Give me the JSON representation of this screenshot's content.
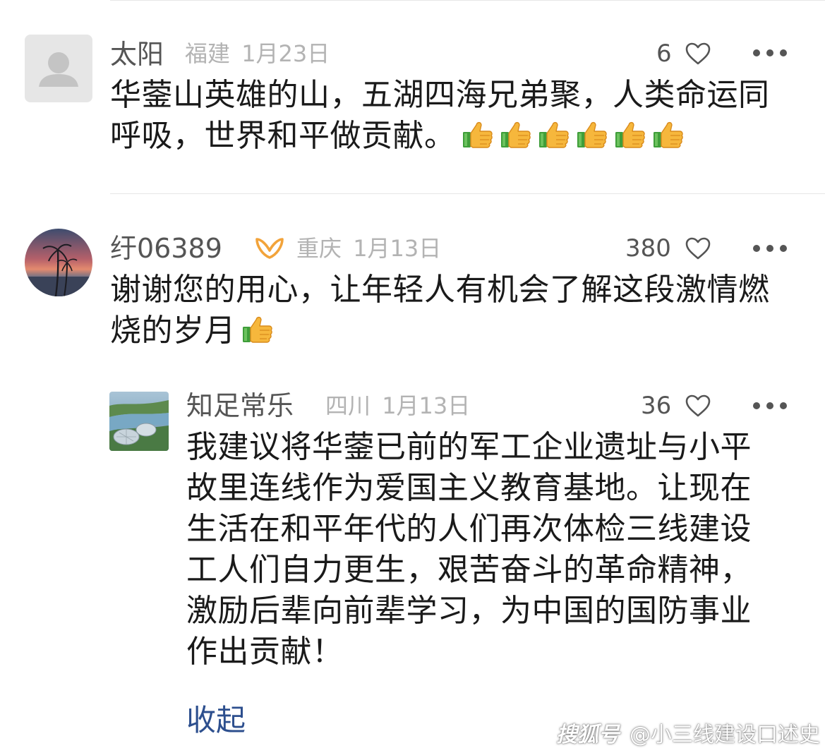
{
  "comments": [
    {
      "username": "太阳",
      "location": "福建",
      "date": "1月23日",
      "likes": "6",
      "text": "华蓥山英雄的山，五湖四海兄弟聚，人类命运同呼吸，世界和平做贡献。",
      "emoji": [
        "thumbs-up",
        "thumbs-up",
        "thumbs-up",
        "thumbs-up",
        "thumbs-up",
        "thumbs-up"
      ]
    },
    {
      "username": "纡06389",
      "location": "重庆",
      "date": "1月13日",
      "likes": "380",
      "text": "谢谢您的用心，让年轻人有机会了解这段激情燃烧的岁月",
      "emoji": [
        "thumbs-up"
      ]
    },
    {
      "username": "知足常乐",
      "location": "四川",
      "date": "1月13日",
      "likes": "36",
      "text": "我建议将华蓥已前的军工企业遗址与小平故里连线作为爱国主义教育基地。让现在生活在和平年代的人们再次体检三线建设工人们自力更生，艰苦奋斗的革命精神，激励后辈向前辈学习，为中国的国防事业作出贡献！",
      "collapse_label": "收起"
    }
  ],
  "watermark": {
    "logo": "搜狐号",
    "handle": "@小三线建设口述史"
  },
  "colors": {
    "accent": "#2d4f8e",
    "meta": "#b3b3b3",
    "text": "#1a1a1a",
    "badge": "#f2a33a"
  }
}
